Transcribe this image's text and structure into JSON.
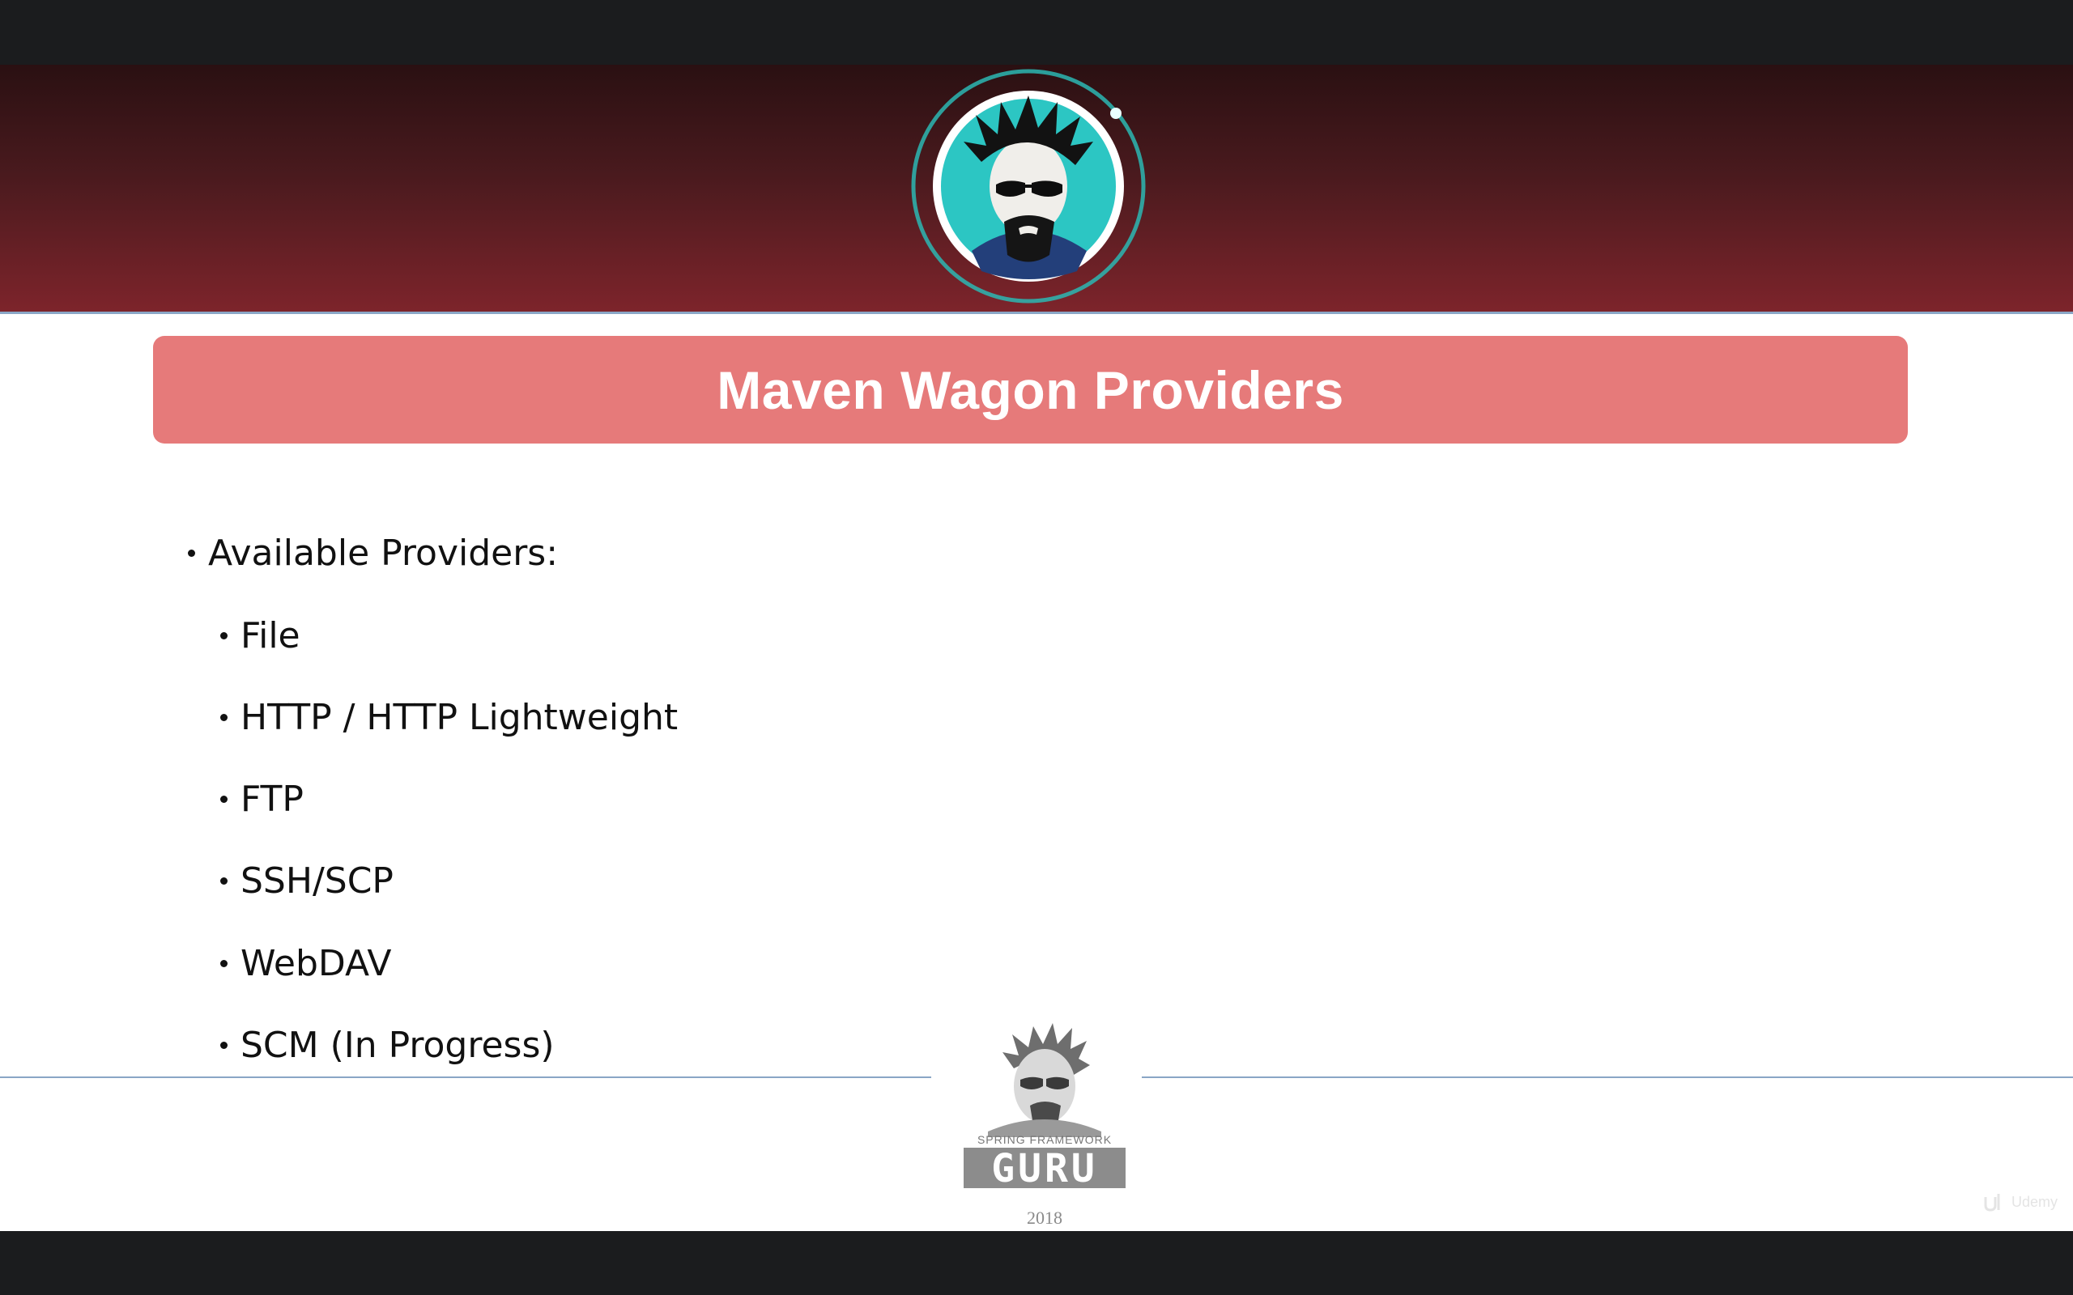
{
  "slide": {
    "title": "Maven Wagon Providers",
    "bullets": [
      {
        "text": "Available Providers:",
        "level": 1
      },
      {
        "text": "File",
        "level": 2
      },
      {
        "text": "HTTP / HTTP Lightweight",
        "level": 2
      },
      {
        "text": "FTP",
        "level": 2
      },
      {
        "text": "SSH/SCP",
        "level": 2
      },
      {
        "text": "WebDAV",
        "level": 2
      },
      {
        "text": "SCM (In Progress)",
        "level": 2
      }
    ]
  },
  "footer": {
    "logo_top_text": "SPRING FRAMEWORK",
    "logo_main_text": "GURU",
    "year": "2018"
  },
  "watermark": {
    "text": "Udemy"
  },
  "colors": {
    "title_box": "#e67a7a",
    "header_dark": "#2a1012",
    "header_light": "#7d242b",
    "divider": "#8aa6c6",
    "avatar_ring": "#2bb7b3"
  },
  "icons": {
    "header_avatar": "guru-avatar-icon",
    "footer_logo": "spring-framework-guru-logo"
  }
}
